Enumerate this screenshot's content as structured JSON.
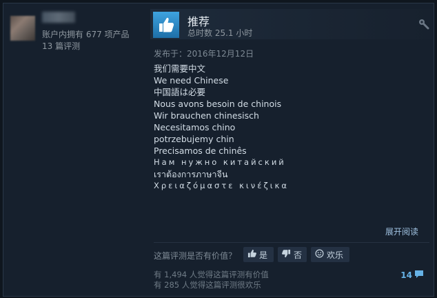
{
  "author": {
    "games_owned": "账户内拥有 677 项产品",
    "review_count": "13 篇评测"
  },
  "review": {
    "recommend_label": "推荐",
    "hours": "总时数 25.1 小时",
    "posted": "发布于：2016年12月12日",
    "lines": [
      "我们需要中文",
      "We need Chinese",
      "中国語は必要",
      "Nous avons besoin de chinois",
      "Wir brauchen chinesisch",
      "Necesitamos chino",
      "potrzebujemy chin",
      "Precisamos de chinês",
      "Нам нужно китайский",
      "เราต้องการภาษาจีน",
      "Χρειαζόμαστε κινέζικα"
    ],
    "expand_label": "展开阅读"
  },
  "feedback": {
    "question": "这篇评测是否有价值？",
    "yes_label": "是",
    "no_label": "否",
    "funny_label": "欢乐",
    "helpful_stat": "有 1,494 人觉得这篇评测有价值",
    "funny_stat": "有 285 人觉得这篇评测很欢乐",
    "comment_count": "14"
  },
  "icons": {
    "thumb": "thumbs-up-icon",
    "wrench": "wrench-icon",
    "yes": "thumbs-up-icon",
    "no": "thumbs-down-icon",
    "funny": "smiley-icon",
    "comment": "comment-icon"
  },
  "colors": {
    "background": "#16202d",
    "thumb_blue": "#3ea3e0",
    "link_blue": "#66b2e6"
  }
}
